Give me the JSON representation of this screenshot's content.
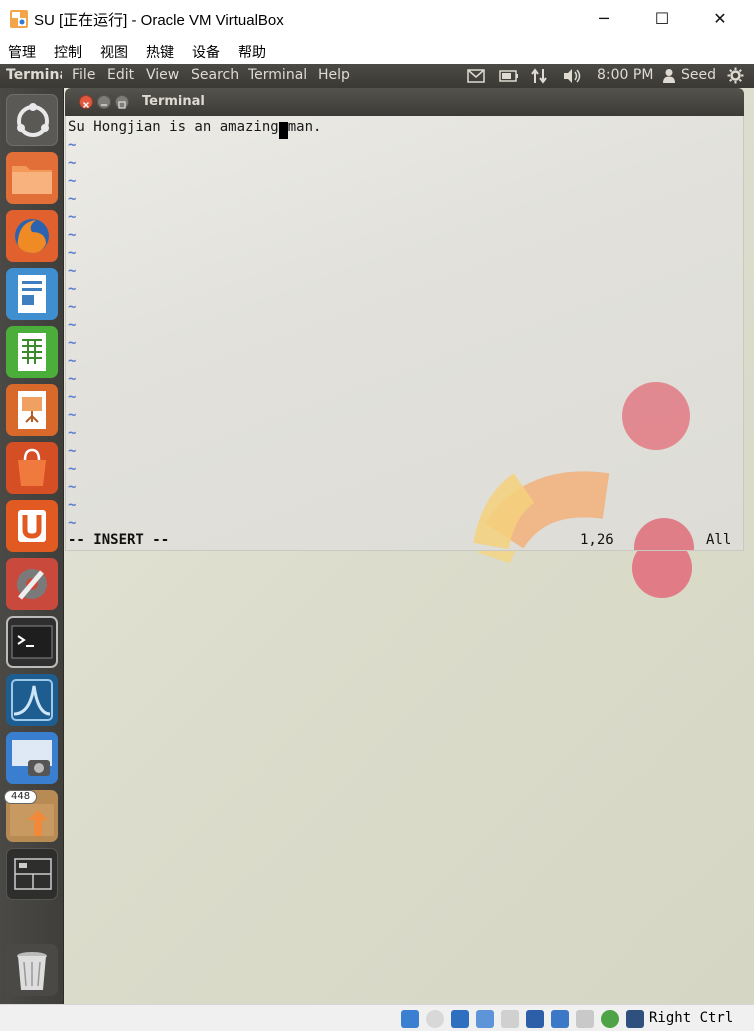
{
  "host_window": {
    "title": "SU [正在运行] - Oracle VM VirtualBox",
    "controls": {
      "minimize": "─",
      "maximize": "☐",
      "close": "✕"
    }
  },
  "host_menu": [
    "管理",
    "控制",
    "视图",
    "热键",
    "设备",
    "帮助"
  ],
  "guest_panel": {
    "app_name": "Terminal",
    "menus": [
      "File",
      "Edit",
      "View",
      "Search",
      "Terminal",
      "Help"
    ],
    "clock": "8:00 PM",
    "user": "Seed"
  },
  "launcher": {
    "badge_count": "448",
    "items": [
      "dash",
      "files",
      "firefox",
      "writer",
      "calc",
      "impress",
      "software-center",
      "ubuntu-one",
      "system-settings",
      "terminal",
      "wireshark",
      "screenshot",
      "update-manager",
      "workspace-switcher",
      "trash"
    ]
  },
  "terminal": {
    "title": "Terminal",
    "line_before_cursor": "Su Hongjian is an amazing",
    "cursor_char": " ",
    "line_after_cursor": "man.",
    "tilde": "~",
    "tilde_count": 22,
    "mode": "-- INSERT --",
    "position": "1,26",
    "scroll": "All"
  },
  "host_status": {
    "host_key": "Right Ctrl"
  },
  "colors": {
    "ubuntu_panel": "#3c3b37",
    "vim_tilde": "#5a7bd0",
    "close_button": "#e2583e"
  }
}
